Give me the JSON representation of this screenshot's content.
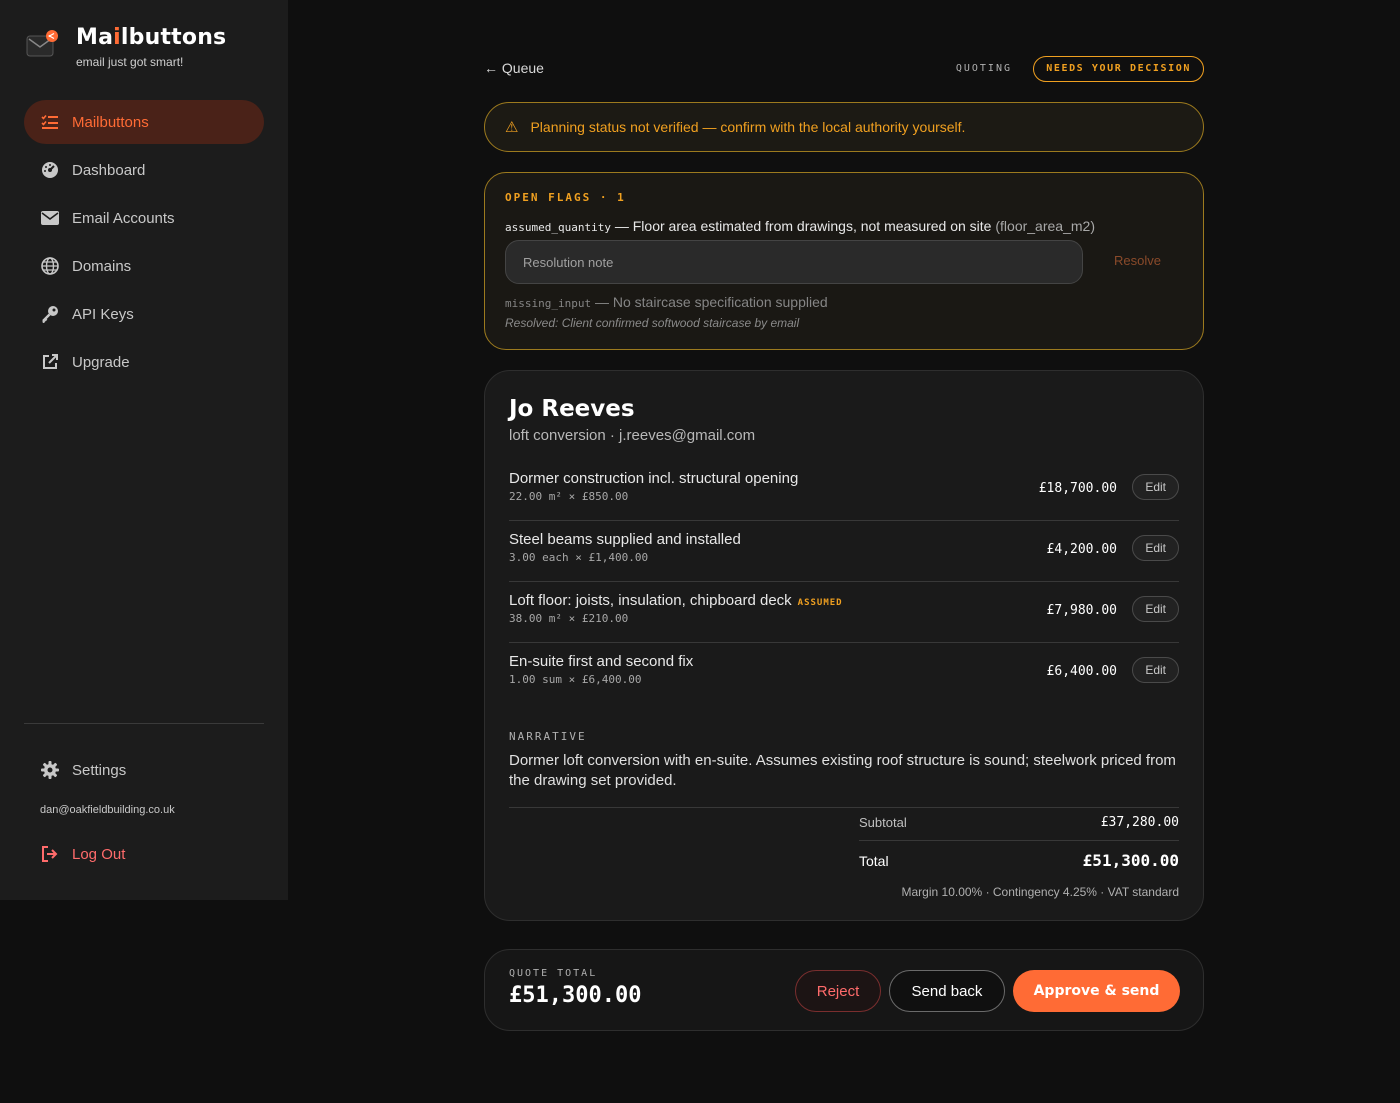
{
  "brand": {
    "name_pre": "Ma",
    "name_accent": "i",
    "name_post": "lbuttons",
    "tagline": "email just got smart!"
  },
  "nav": {
    "items": [
      {
        "label": "Mailbuttons",
        "icon": "list-check-icon",
        "active": true
      },
      {
        "label": "Dashboard",
        "icon": "gauge-icon"
      },
      {
        "label": "Email Accounts",
        "icon": "envelope-icon"
      },
      {
        "label": "Domains",
        "icon": "globe-icon"
      },
      {
        "label": "API Keys",
        "icon": "key-icon"
      },
      {
        "label": "Upgrade",
        "icon": "external-link-icon"
      }
    ],
    "settings_label": "Settings",
    "user_email": "dan@oakfieldbuilding.co.uk",
    "logout_label": "Log Out"
  },
  "topbar": {
    "back_label": "← Queue",
    "status_label": "QUOTING",
    "status_badge": "NEEDS YOUR DECISION"
  },
  "warning": {
    "icon": "⚠",
    "text": "Planning status not verified — confirm with the local authority yourself."
  },
  "flags": {
    "heading": "OPEN FLAGS · 1",
    "open": {
      "code": "assumed_quantity",
      "text": " — Floor area estimated from drawings, not measured on site ",
      "field": "(floor_area_m2)"
    },
    "resolution_placeholder": "Resolution note",
    "resolve_label": "Resolve",
    "resolved": {
      "code": "missing_input",
      "text": " — No staircase specification supplied",
      "note": "Resolved: Client confirmed softwood staircase by email"
    }
  },
  "quote": {
    "client_name": "Jo Reeves",
    "client_sub": "loft conversion · j.reeves@gmail.com",
    "line_items": [
      {
        "desc": "Dormer construction incl. structural opening",
        "tag": "",
        "calc": "22.00 m² × £850.00",
        "amount": "£18,700.00",
        "edit": "Edit"
      },
      {
        "desc": "Steel beams supplied and installed",
        "tag": "",
        "calc": "3.00 each × £1,400.00",
        "amount": "£4,200.00",
        "edit": "Edit"
      },
      {
        "desc": "Loft floor: joists, insulation, chipboard deck",
        "tag": "ASSUMED",
        "calc": "38.00 m² × £210.00",
        "amount": "£7,980.00",
        "edit": "Edit"
      },
      {
        "desc": "En-suite first and second fix",
        "tag": "",
        "calc": "1.00 sum × £6,400.00",
        "amount": "£6,400.00",
        "edit": "Edit"
      }
    ],
    "narrative_heading": "NARRATIVE",
    "narrative": "Dormer loft conversion with en-suite. Assumes existing roof structure is sound; steelwork priced from the drawing set provided.",
    "subtotal_label": "Subtotal",
    "subtotal": "£37,280.00",
    "total_label": "Total",
    "total": "£51,300.00",
    "meta": "Margin 10.00% · Contingency 4.25% · VAT standard"
  },
  "actions": {
    "quote_total_label": "QUOTE TOTAL",
    "quote_total": "£51,300.00",
    "reject_label": "Reject",
    "send_back_label": "Send back",
    "approve_label": "Approve & send"
  },
  "colors": {
    "accent": "#ff6b35",
    "warning": "#f0a020",
    "danger": "#ff6b6b"
  }
}
